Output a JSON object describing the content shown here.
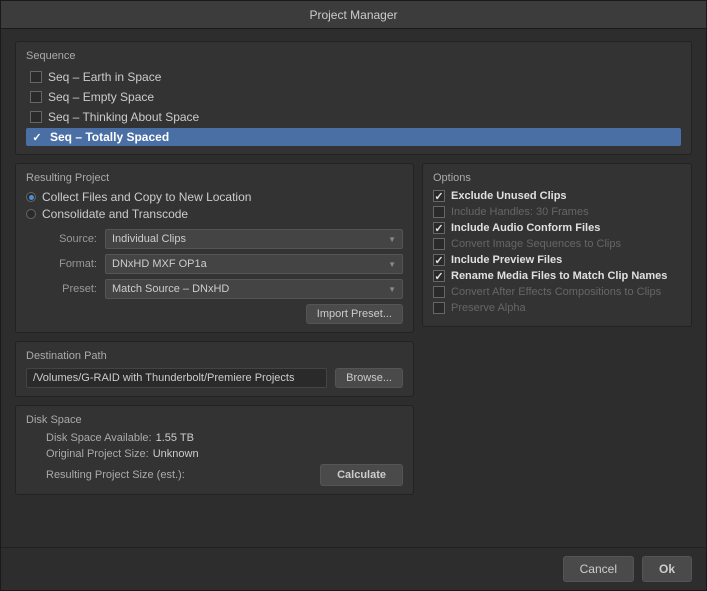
{
  "window": {
    "title": "Project Manager"
  },
  "sequence": {
    "label": "Sequence",
    "items": [
      {
        "id": "seq1",
        "name": "Seq – Earth in Space",
        "checked": false,
        "selected": false
      },
      {
        "id": "seq2",
        "name": "Seq – Empty Space",
        "checked": false,
        "selected": false
      },
      {
        "id": "seq3",
        "name": "Seq – Thinking About Space",
        "checked": false,
        "selected": false
      },
      {
        "id": "seq4",
        "name": "Seq – Totally Spaced",
        "checked": true,
        "selected": true
      }
    ]
  },
  "resulting_project": {
    "label": "Resulting Project",
    "options": [
      {
        "id": "collect",
        "label": "Collect Files and Copy to New Location",
        "selected": true
      },
      {
        "id": "consolidate",
        "label": "Consolidate and Transcode",
        "selected": false
      }
    ],
    "source_label": "Source:",
    "source_value": "Individual Clips",
    "format_label": "Format:",
    "format_value": "DNxHD MXF OP1a",
    "preset_label": "Preset:",
    "preset_value": "Match Source – DNxHD",
    "import_preset_button": "Import Preset..."
  },
  "options": {
    "label": "Options",
    "items": [
      {
        "id": "exclude_unused",
        "label": "Exclude Unused Clips",
        "checked": true,
        "bold": true,
        "disabled": false
      },
      {
        "id": "include_handles",
        "label": "Include Handles:  30 Frames",
        "checked": false,
        "bold": false,
        "disabled": true
      },
      {
        "id": "include_audio",
        "label": "Include Audio Conform Files",
        "checked": true,
        "bold": true,
        "disabled": false
      },
      {
        "id": "convert_image",
        "label": "Convert Image Sequences to Clips",
        "checked": false,
        "bold": false,
        "disabled": true
      },
      {
        "id": "include_preview",
        "label": "Include Preview Files",
        "checked": true,
        "bold": true,
        "disabled": false
      },
      {
        "id": "rename_media",
        "label": "Rename Media Files to Match Clip Names",
        "checked": true,
        "bold": true,
        "disabled": false
      },
      {
        "id": "convert_effects",
        "label": "Convert After Effects Compositions to Clips",
        "checked": false,
        "bold": false,
        "disabled": true
      },
      {
        "id": "preserve_alpha",
        "label": "Preserve Alpha",
        "checked": false,
        "bold": false,
        "disabled": true
      }
    ]
  },
  "destination_path": {
    "label": "Destination Path",
    "path": "/Volumes/G-RAID with Thunderbolt/Premiere Projects",
    "browse_button": "Browse..."
  },
  "disk_space": {
    "label": "Disk Space",
    "available_label": "Disk Space Available:",
    "available_value": "1.55 TB",
    "original_label": "Original Project Size:",
    "original_value": "Unknown",
    "resulting_label": "Resulting Project Size (est.):",
    "calculate_button": "Calculate"
  },
  "footer": {
    "cancel_button": "Cancel",
    "ok_button": "Ok"
  }
}
